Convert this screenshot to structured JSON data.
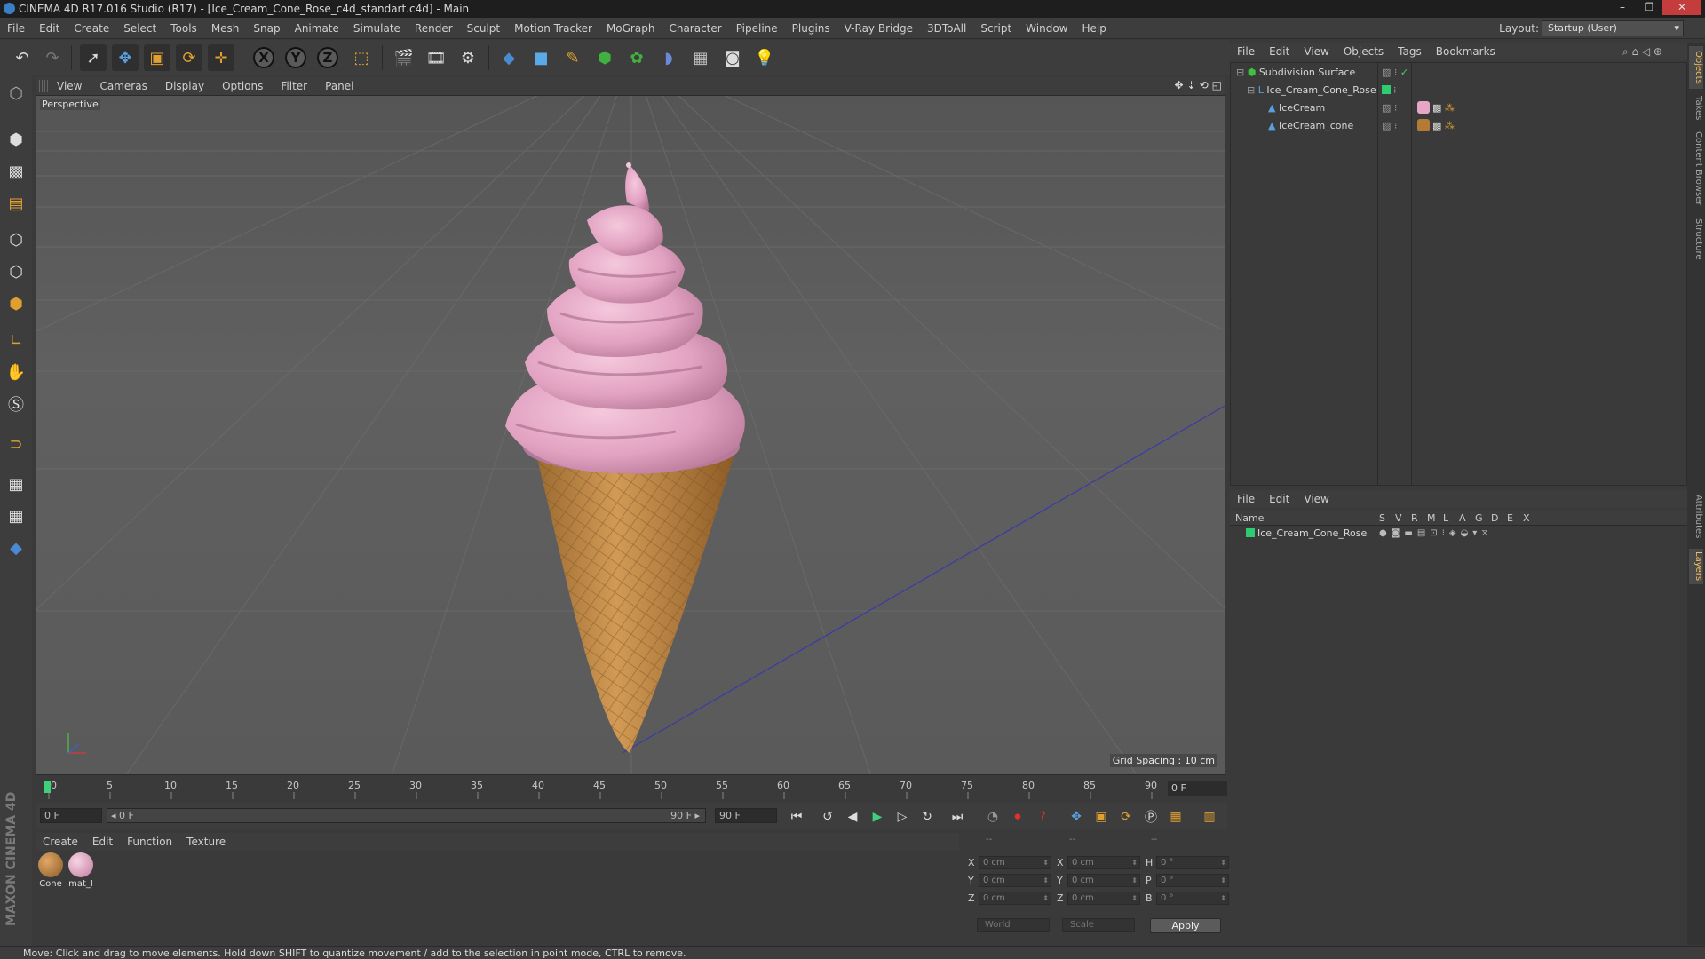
{
  "window": {
    "title": "CINEMA 4D R17.016 Studio (R17) - [Ice_Cream_Cone_Rose_c4d_standart.c4d] - Main",
    "controls": [
      "–",
      "❐",
      "✕"
    ]
  },
  "menubar": {
    "items": [
      "File",
      "Edit",
      "Create",
      "Select",
      "Tools",
      "Mesh",
      "Snap",
      "Animate",
      "Simulate",
      "Render",
      "Sculpt",
      "Motion Tracker",
      "MoGraph",
      "Character",
      "Pipeline",
      "Plugins",
      "V-Ray Bridge",
      "3DToAll",
      "Script",
      "Window",
      "Help"
    ],
    "layout_label": "Layout:",
    "layout_value": "Startup (User)"
  },
  "toolbar": {
    "axis_x": "X",
    "axis_y": "Y",
    "axis_z": "Z"
  },
  "viewport": {
    "menus": [
      "View",
      "Cameras",
      "Display",
      "Options",
      "Filter",
      "Panel"
    ],
    "camera_label": "Perspective",
    "grid_spacing": "Grid Spacing : 10 cm",
    "nav_icons": [
      "✥",
      "⇣",
      "⟲",
      "◱"
    ]
  },
  "timeline": {
    "ticks": [
      "0",
      "5",
      "10",
      "15",
      "20",
      "25",
      "30",
      "35",
      "40",
      "45",
      "50",
      "55",
      "60",
      "65",
      "70",
      "75",
      "80",
      "85",
      "90"
    ],
    "end_frame_display": "0 F",
    "current_frame": "0 F",
    "range_start": "◂ 0 F",
    "range_end": "90 F ▸",
    "end_frame": "90 F"
  },
  "materials": {
    "menus": [
      "Create",
      "Edit",
      "Function",
      "Texture"
    ],
    "items": [
      {
        "label": "Cone",
        "color": "#b57a35"
      },
      {
        "label": "mat_I",
        "color": "#e6a6c6"
      }
    ]
  },
  "coordinates": {
    "header": [
      "--",
      "--",
      "--"
    ],
    "rows": [
      {
        "a": "X",
        "av": "0 cm",
        "b": "X",
        "bv": "0 cm",
        "c": "H",
        "cv": "0 °"
      },
      {
        "a": "Y",
        "av": "0 cm",
        "b": "Y",
        "bv": "0 cm",
        "c": "P",
        "cv": "0 °"
      },
      {
        "a": "Z",
        "av": "0 cm",
        "b": "Z",
        "bv": "0 cm",
        "c": "B",
        "cv": "0 °"
      }
    ],
    "space": "World",
    "mode": "Scale",
    "apply": "Apply"
  },
  "objects": {
    "menus": [
      "File",
      "Edit",
      "View",
      "Objects",
      "Tags",
      "Bookmarks"
    ],
    "items": [
      {
        "name": "Subdivision Surface",
        "indent": 0
      },
      {
        "name": "Ice_Cream_Cone_Rose",
        "indent": 1
      },
      {
        "name": "IceCream",
        "indent": 2
      },
      {
        "name": "IceCream_cone",
        "indent": 2
      }
    ]
  },
  "layers": {
    "menus": [
      "File",
      "Edit",
      "View"
    ],
    "columns": [
      "Name",
      "S",
      "V",
      "R",
      "M",
      "L",
      "A",
      "G",
      "D",
      "E",
      "X"
    ],
    "items": [
      {
        "name": "Ice_Cream_Cone_Rose",
        "color": "#2ecc71"
      }
    ]
  },
  "side_tabs": [
    "Objects",
    "Takes",
    "Content Browser",
    "Structure",
    "Attributes",
    "Layers"
  ],
  "branding": {
    "logo": "MAXON CINEMA 4D"
  },
  "status": "Move: Click and drag to move elements. Hold down SHIFT to quantize movement / add to the selection in point mode, CTRL to remove.",
  "colors": {
    "accent": "#5a9fd6",
    "icecream": "#e8a8c8",
    "cone": "#c08a48",
    "layer_green": "#2ecc71"
  }
}
